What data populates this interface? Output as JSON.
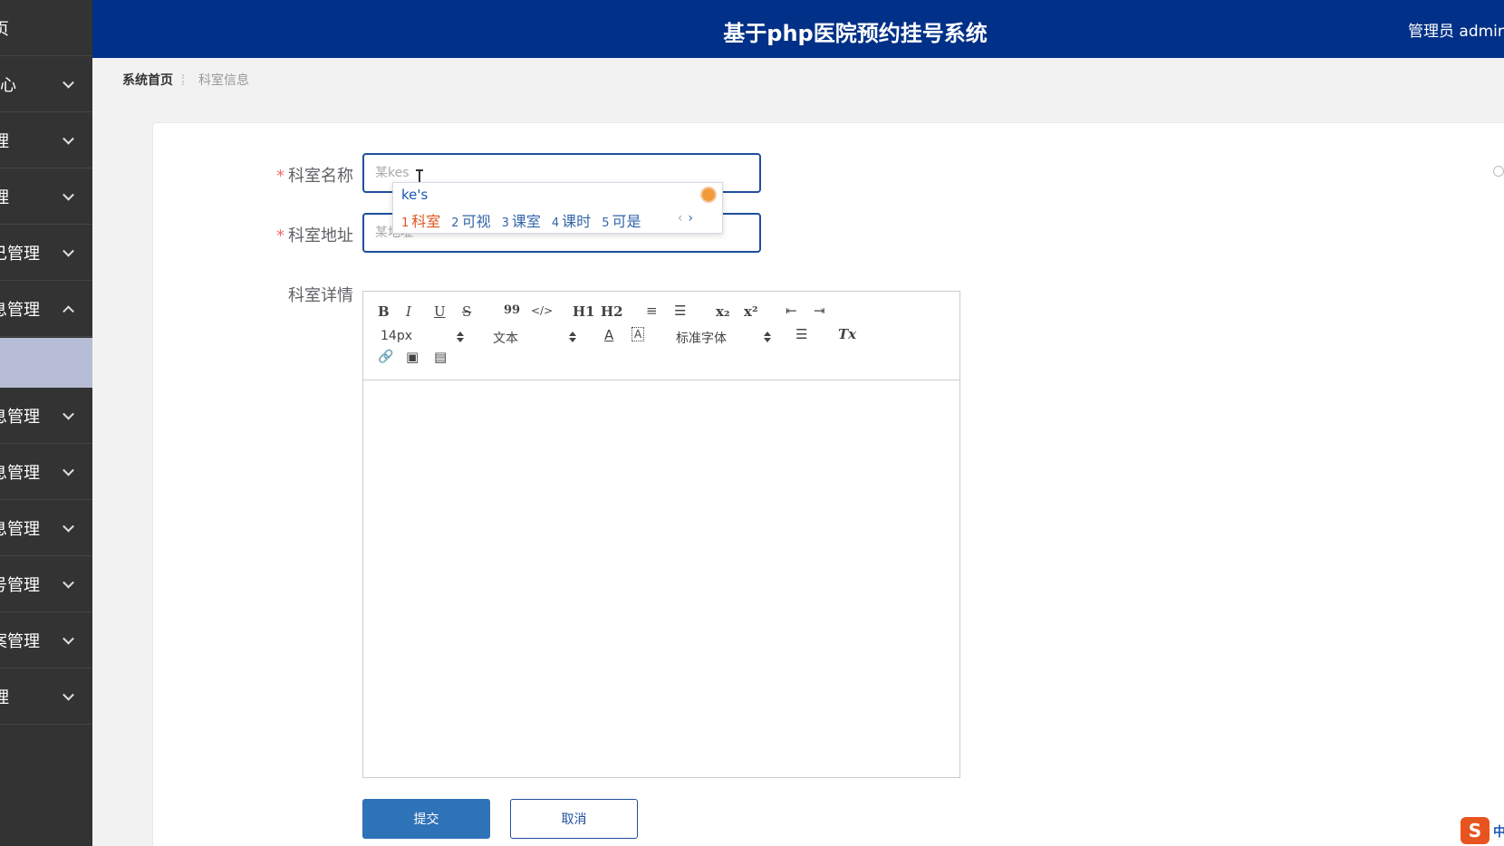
{
  "header": {
    "title": "基于php医院预约挂号系统",
    "user": "管理员 admin"
  },
  "sidebar": {
    "items": [
      {
        "label": "页",
        "chevron": "none"
      },
      {
        "label": "心",
        "chevron": "down"
      },
      {
        "label": "理",
        "chevron": "down"
      },
      {
        "label": "理",
        "chevron": "down"
      },
      {
        "label": "己管理",
        "chevron": "down"
      },
      {
        "label": "息管理",
        "chevron": "up"
      },
      {
        "label": "息管理",
        "chevron": "down"
      },
      {
        "label": "息管理",
        "chevron": "down"
      },
      {
        "label": "息管理",
        "chevron": "down"
      },
      {
        "label": "号管理",
        "chevron": "down"
      },
      {
        "label": "案管理",
        "chevron": "down"
      },
      {
        "label": "理",
        "chevron": "down"
      }
    ]
  },
  "breadcrumb": {
    "home": "系统首页",
    "current": "科室信息"
  },
  "form": {
    "name_label": "科室名称",
    "name_value": "某kes",
    "address_label": "科室地址",
    "address_placeholder": "某地址",
    "detail_label": "科室详情"
  },
  "ime": {
    "composition": "ke's",
    "candidates": [
      {
        "num": "1",
        "text": "科室"
      },
      {
        "num": "2",
        "text": "可视"
      },
      {
        "num": "3",
        "text": "课室"
      },
      {
        "num": "4",
        "text": "课时"
      },
      {
        "num": "5",
        "text": "可是"
      }
    ],
    "prev": "‹",
    "next": "›"
  },
  "editor": {
    "size_value": "14px",
    "header_value": "文本",
    "font_value": "标准字体",
    "buttons": {
      "bold": "B",
      "italic": "I",
      "underline": "U",
      "strike": "S",
      "quote": "99",
      "code": "</>",
      "h1": "H1",
      "h2": "H2",
      "ordered": "≡",
      "bullet": "☰",
      "sub": "x₂",
      "sup": "x²",
      "outdent": "⇤",
      "indent": "⇥",
      "color": "A",
      "background": "A",
      "align": "☰",
      "clean": "Tx",
      "link": "🔗",
      "image": "▣",
      "video": "▤"
    }
  },
  "buttons": {
    "submit": "提交",
    "cancel": "取消"
  },
  "ime_bar": {
    "logo": "S",
    "mode": "中"
  }
}
